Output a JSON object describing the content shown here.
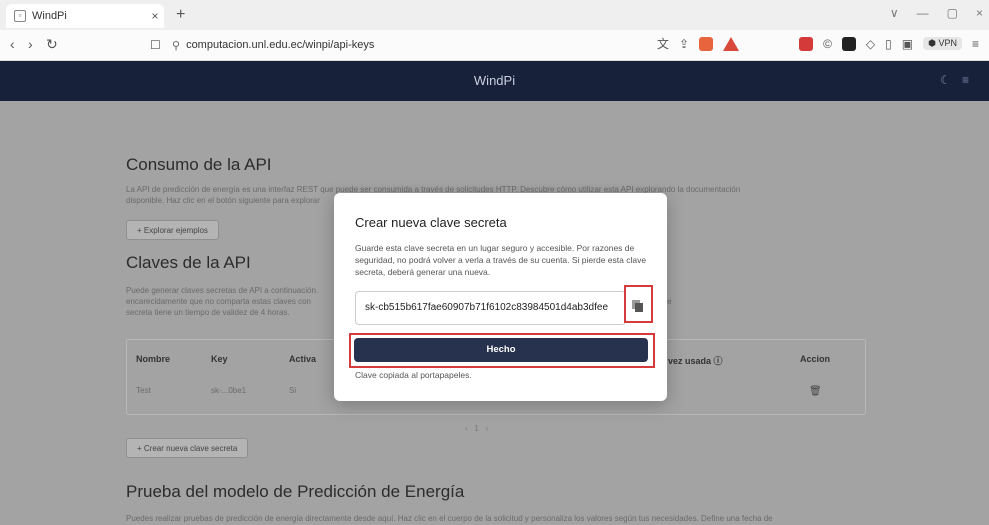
{
  "browser": {
    "tab_title": "WindPi",
    "tab_close": "×",
    "new_tab": "+",
    "url": "computacion.unl.edu.ec/winpi/api-keys",
    "vpn": "VPN",
    "window_controls": [
      "∨",
      "—",
      "▢",
      "×"
    ]
  },
  "app": {
    "title": "WindPi"
  },
  "sections": {
    "consumo_title": "Consumo de la API",
    "consumo_desc_1": "La API de predicción de energía es una interfaz REST que puede ser consumida a través de solicitudes HTTP. Descubre cómo utilizar esta API explorando la documentación",
    "consumo_desc_2": "disponible. Haz clic en el botón siguiente para explorar",
    "explore_button": "+ Explorar ejemplos",
    "claves_title": "Claves de la API",
    "claves_desc_1": "Puede generar claves secretas de API a continuación.                                                                                     olver a mostrarse. Le recomendamos",
    "claves_desc_2": "encarecidamente que no comparta estas claves con                                                                                        r motivos de seguridad del usuario, cada clave",
    "claves_desc_3": "secreta tiene un tiempo de validez de 4 horas.",
    "create_button": "+ Crear nueva clave secreta",
    "prueba_title": "Prueba del modelo de Predicción de Energía",
    "prueba_desc": "Puedes realizar pruebas de predicción de energía directamente desde aquí. Haz clic en el cuerpo de la solicitud y personaliza los valores según tus necesidades. Define una fecha de"
  },
  "table": {
    "headers": {
      "nombre": "Nombre",
      "key": "Key",
      "activa": "Activa",
      "ultima": "vez usada ⓘ",
      "accion": "Accion"
    },
    "row": {
      "nombre": "Test",
      "key": "sk-...0be1",
      "activa": "Si"
    },
    "pagination": "‹   1   ›"
  },
  "modal": {
    "title": "Crear nueva clave secreta",
    "description": "Guarde esta clave secreta en un lugar seguro y accesible. Por razones de seguridad, no podrá volver a verla a través de su cuenta. Si pierde esta clave secreta, deberá generar una nueva.",
    "secret_key": "sk-cb515b617fae60907b71f6102c83984501d4ab3dfee",
    "done_button": "Hecho",
    "copied_message": "Clave copiada al portapapeles.",
    "highlight_color": "#d63a3a",
    "primary_color": "#27324f"
  }
}
